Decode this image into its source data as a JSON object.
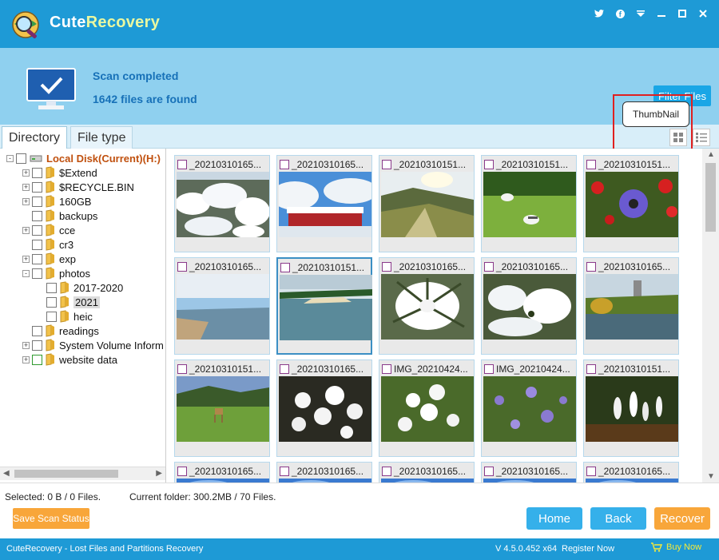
{
  "app": {
    "title_part1": "Cute",
    "title_part2": "Recovery",
    "window_buttons": [
      "twitter-icon",
      "facebook-icon",
      "menu-icon",
      "minimize-icon",
      "maximize-icon",
      "close-icon"
    ]
  },
  "scan": {
    "status": "Scan completed",
    "count_text": "1642 files are found",
    "filter_label": "Filter Files"
  },
  "tabs": [
    {
      "label": "Directory",
      "active": true
    },
    {
      "label": "File type",
      "active": false
    }
  ],
  "tooltip": "ThumbNail",
  "tree": [
    {
      "label": "Local Disk(Current)(H:)",
      "level": 0,
      "expander": "-",
      "root": true
    },
    {
      "label": "$Extend",
      "level": 1,
      "expander": "+"
    },
    {
      "label": "$RECYCLE.BIN",
      "level": 1,
      "expander": "+"
    },
    {
      "label": "160GB",
      "level": 1,
      "expander": "+"
    },
    {
      "label": "backups",
      "level": 1,
      "expander": ""
    },
    {
      "label": "cce",
      "level": 1,
      "expander": "+"
    },
    {
      "label": "cr3",
      "level": 1,
      "expander": ""
    },
    {
      "label": "exp",
      "level": 1,
      "expander": "+"
    },
    {
      "label": "photos",
      "level": 1,
      "expander": "-"
    },
    {
      "label": "2017-2020",
      "level": 2,
      "expander": ""
    },
    {
      "label": "2021",
      "level": 2,
      "expander": "",
      "selected": true
    },
    {
      "label": "heic",
      "level": 2,
      "expander": ""
    },
    {
      "label": "readings",
      "level": 1,
      "expander": ""
    },
    {
      "label": "System Volume Inform",
      "level": 1,
      "expander": "+"
    },
    {
      "label": "website data",
      "level": 1,
      "expander": "+",
      "green": true
    }
  ],
  "thumbnails": [
    {
      "name": "_20210310165...",
      "scene": "snow"
    },
    {
      "name": "_20210310165...",
      "scene": "snow-roof"
    },
    {
      "name": "_20210310151...",
      "scene": "valley"
    },
    {
      "name": "_20210310151...",
      "scene": "gulls"
    },
    {
      "name": "_20210310151...",
      "scene": "anemone"
    },
    {
      "name": "_20210310165...",
      "scene": "beach"
    },
    {
      "name": "_20210310151...",
      "scene": "sea",
      "selected": true
    },
    {
      "name": "_20210310165...",
      "scene": "snow-plant"
    },
    {
      "name": "_20210310165...",
      "scene": "snow-bush"
    },
    {
      "name": "_20210310165...",
      "scene": "lake"
    },
    {
      "name": "_20210310151...",
      "scene": "deer"
    },
    {
      "name": "_20210310165...",
      "scene": "white-flowers"
    },
    {
      "name": "IMG_20210424...",
      "scene": "white-flowers2"
    },
    {
      "name": "IMG_20210424...",
      "scene": "purple-flowers"
    },
    {
      "name": "_20210310151...",
      "scene": "crocus"
    },
    {
      "name": "_20210310165...",
      "scene": "sky"
    },
    {
      "name": "_20210310165...",
      "scene": "sky"
    },
    {
      "name": "_20210310165...",
      "scene": "sky"
    },
    {
      "name": "_20210310165...",
      "scene": "sky"
    },
    {
      "name": "_20210310165...",
      "scene": "sky"
    }
  ],
  "bottom": {
    "selected": "Selected: 0 B / 0 Files.",
    "current_folder": "Current folder: 300.2MB / 70 Files.",
    "save_label": "Save Scan Status",
    "home_label": "Home",
    "back_label": "Back",
    "recover_label": "Recover"
  },
  "statusbar": {
    "left": "CuteRecovery - Lost Files and Partitions Recovery",
    "version": "V 4.5.0.452 x64",
    "register": "Register Now",
    "buy": "Buy Now"
  },
  "colors": {
    "accent": "#1e9ad6",
    "header_bg": "#8fd0ef",
    "orange": "#f8a63a",
    "button_blue": "#35b0ea"
  }
}
